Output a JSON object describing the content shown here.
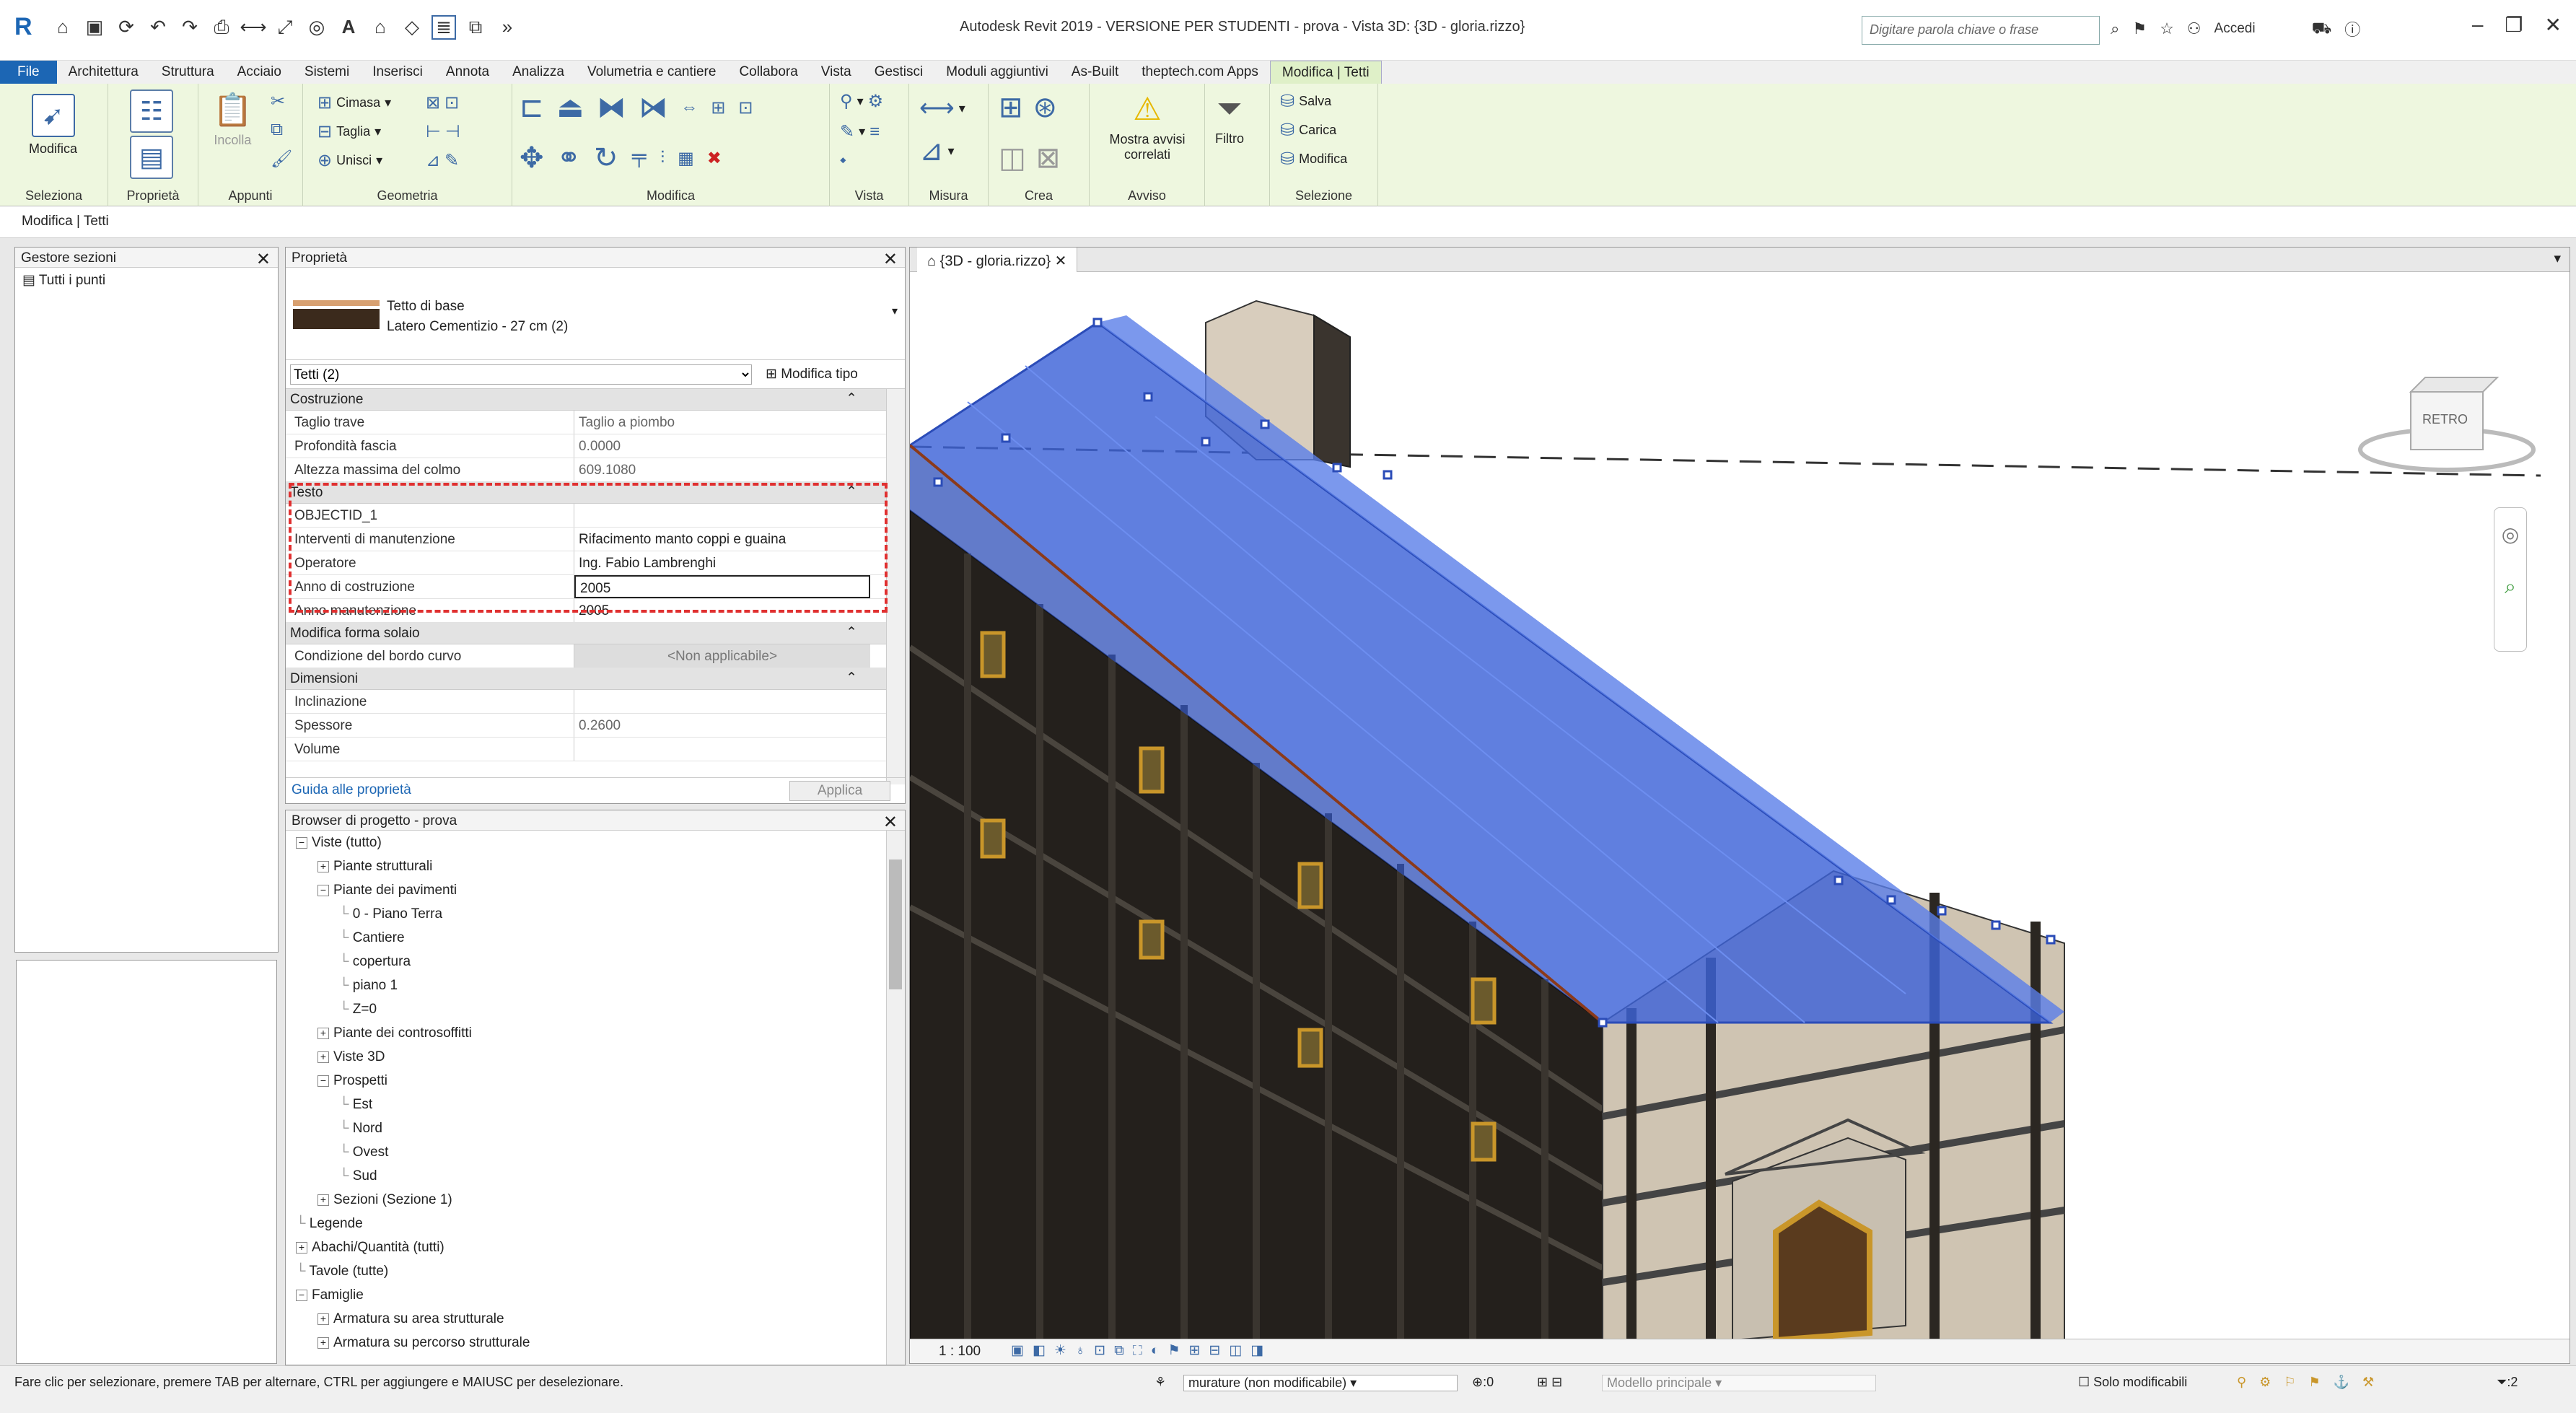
{
  "window": {
    "title": "Autodesk Revit 2019 - VERSIONE PER STUDENTI - prova - Vista 3D: {3D - gloria.rizzo}",
    "search_placeholder": "Digitare parola chiave o frase",
    "sign_in": "Accedi"
  },
  "tabs": [
    "File",
    "Architettura",
    "Struttura",
    "Acciaio",
    "Sistemi",
    "Inserisci",
    "Annota",
    "Analizza",
    "Volumetria e cantiere",
    "Collabora",
    "Vista",
    "Gestisci",
    "Moduli aggiuntivi",
    "As-Built",
    "theptech.com Apps",
    "Modifica | Tetti"
  ],
  "ribbon": {
    "seleziona": {
      "button": "Modifica",
      "title": "Seleziona"
    },
    "proprieta": {
      "title": "Proprietà"
    },
    "appunti": {
      "incolla": "Incolla",
      "title": "Appunti"
    },
    "geometria": {
      "cimasa": "Cimasa",
      "taglia": "Taglia",
      "unisci": "Unisci",
      "title": "Geometria"
    },
    "modifica": {
      "title": "Modifica"
    },
    "vista": {
      "title": "Vista"
    },
    "misura": {
      "title": "Misura"
    },
    "crea": {
      "title": "Crea"
    },
    "avviso": {
      "mostra": "Mostra avvisi correlati",
      "title": "Avviso"
    },
    "filtro": {
      "label": "Filtro"
    },
    "selezione": {
      "salva": "Salva",
      "carica": "Carica",
      "modifica": "Modifica",
      "title": "Selezione"
    }
  },
  "context": "Modifica | Tetti",
  "gestore": {
    "title": "Gestore sezioni",
    "item": "Tutti i punti"
  },
  "properties": {
    "title": "Proprietà",
    "type_name": "Tetto di base",
    "type_detail": "Latero Cementizio - 27 cm (2)",
    "instance": "Tetti (2)",
    "edit_type": "Modifica tipo",
    "groups": {
      "costruzione": "Costruzione",
      "testo": "Testo",
      "forma": "Modifica forma solaio",
      "dimensioni": "Dimensioni"
    },
    "costruzione_rows": [
      {
        "k": "Taglio trave",
        "v": "Taglio a piombo"
      },
      {
        "k": "Profondità fascia",
        "v": "0.0000"
      },
      {
        "k": "Altezza massima del colmo",
        "v": "609.1080"
      }
    ],
    "testo_rows": [
      {
        "k": "OBJECTID_1",
        "v": ""
      },
      {
        "k": "Interventi di manutenzione",
        "v": "Rifacimento manto coppi e guaina"
      },
      {
        "k": "Operatore",
        "v": "Ing. Fabio Lambrenghi"
      },
      {
        "k": "Anno di costruzione",
        "v": "2005"
      },
      {
        "k": "Anno manutenzione",
        "v": "2005"
      }
    ],
    "forma_rows": [
      {
        "k": "Condizione del bordo curvo",
        "v": "<Non applicabile>"
      }
    ],
    "dimensioni_rows": [
      {
        "k": "Inclinazione",
        "v": ""
      },
      {
        "k": "Spessore",
        "v": "0.2600"
      },
      {
        "k": "Volume",
        "v": ""
      }
    ],
    "help": "Guida alle proprietà",
    "apply": "Applica"
  },
  "browser": {
    "title": "Browser di progetto - prova",
    "nodes": [
      {
        "label": "Viste (tutto)",
        "level": 0,
        "pm": "−"
      },
      {
        "label": "Piante strutturali",
        "level": 1,
        "pm": "+"
      },
      {
        "label": "Piante dei pavimenti",
        "level": 1,
        "pm": "−"
      },
      {
        "label": "0 - Piano Terra",
        "level": 2,
        "pm": ""
      },
      {
        "label": "Cantiere",
        "level": 2,
        "pm": ""
      },
      {
        "label": "copertura",
        "level": 2,
        "pm": ""
      },
      {
        "label": "piano 1",
        "level": 2,
        "pm": ""
      },
      {
        "label": "Z=0",
        "level": 2,
        "pm": ""
      },
      {
        "label": "Piante dei controsoffitti",
        "level": 1,
        "pm": "+"
      },
      {
        "label": "Viste 3D",
        "level": 1,
        "pm": "+"
      },
      {
        "label": "Prospetti",
        "level": 1,
        "pm": "−"
      },
      {
        "label": "Est",
        "level": 2,
        "pm": ""
      },
      {
        "label": "Nord",
        "level": 2,
        "pm": ""
      },
      {
        "label": "Ovest",
        "level": 2,
        "pm": ""
      },
      {
        "label": "Sud",
        "level": 2,
        "pm": ""
      },
      {
        "label": "Sezioni (Sezione 1)",
        "level": 1,
        "pm": "+"
      },
      {
        "label": "Legende",
        "level": 0,
        "pm": ""
      },
      {
        "label": "Abachi/Quantità (tutti)",
        "level": 0,
        "pm": "+"
      },
      {
        "label": "Tavole (tutte)",
        "level": 0,
        "pm": ""
      },
      {
        "label": "Famiglie",
        "level": 0,
        "pm": "−"
      },
      {
        "label": "Armatura su area strutturale",
        "level": 1,
        "pm": "+"
      },
      {
        "label": "Armatura su percorso strutturale",
        "level": 1,
        "pm": "+"
      }
    ]
  },
  "viewport": {
    "tab": "{3D - gloria.rizzo}",
    "viewcube_label": "RETRO",
    "scale": "1 : 100"
  },
  "status": {
    "hint": "Fare clic per selezionare, premere TAB per alternare, CTRL per aggiungere e MAIUSC per deselezionare.",
    "workset": "murature (non modificabile)",
    "zero": ":0",
    "model": "Modello principale",
    "only_editable": "Solo modificabili",
    "filter_count": ":2"
  },
  "colors": {
    "roof": "#3d63d8",
    "wall": "#1e1a16",
    "trim": "#c9962a",
    "facade": "#cfc4b2"
  }
}
